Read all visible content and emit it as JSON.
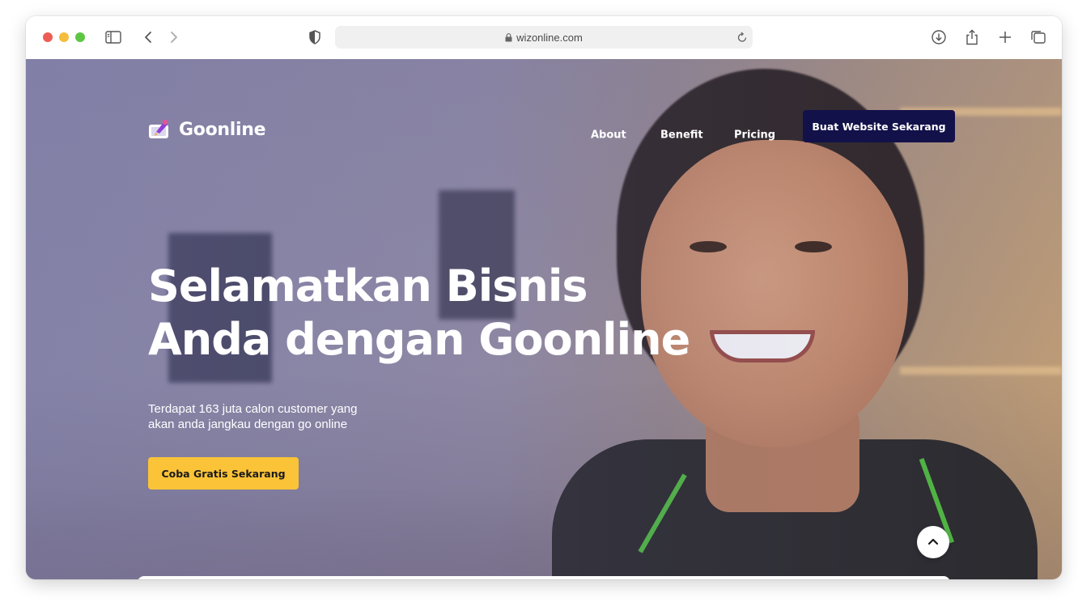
{
  "browser": {
    "url": "wizonline.com"
  },
  "site": {
    "brand": "Goonline",
    "nav": {
      "about": "About",
      "benefit": "Benefit",
      "pricing": "Pricing",
      "cta": "Buat Website Sekarang"
    },
    "hero": {
      "headline_line1": "Selamatkan Bisnis",
      "headline_line2": "Anda dengan Goonline",
      "sub_line1": "Terdapat 163 juta calon customer yang",
      "sub_line2": "akan anda jangkau dengan go online",
      "cta": "Coba Gratis Sekarang"
    }
  },
  "icons": {
    "toolbar": [
      "sidebar-icon",
      "back-icon",
      "forward-icon",
      "shield-icon",
      "lock-icon",
      "reload-icon",
      "download-icon",
      "share-icon",
      "new-tab-icon",
      "tabs-overview-icon"
    ],
    "page": [
      "logo-icon",
      "chevron-up-icon"
    ]
  },
  "colors": {
    "nav_cta_bg": "#13114a",
    "hero_cta_bg": "#fbc338",
    "hero_text": "#ffffff"
  }
}
